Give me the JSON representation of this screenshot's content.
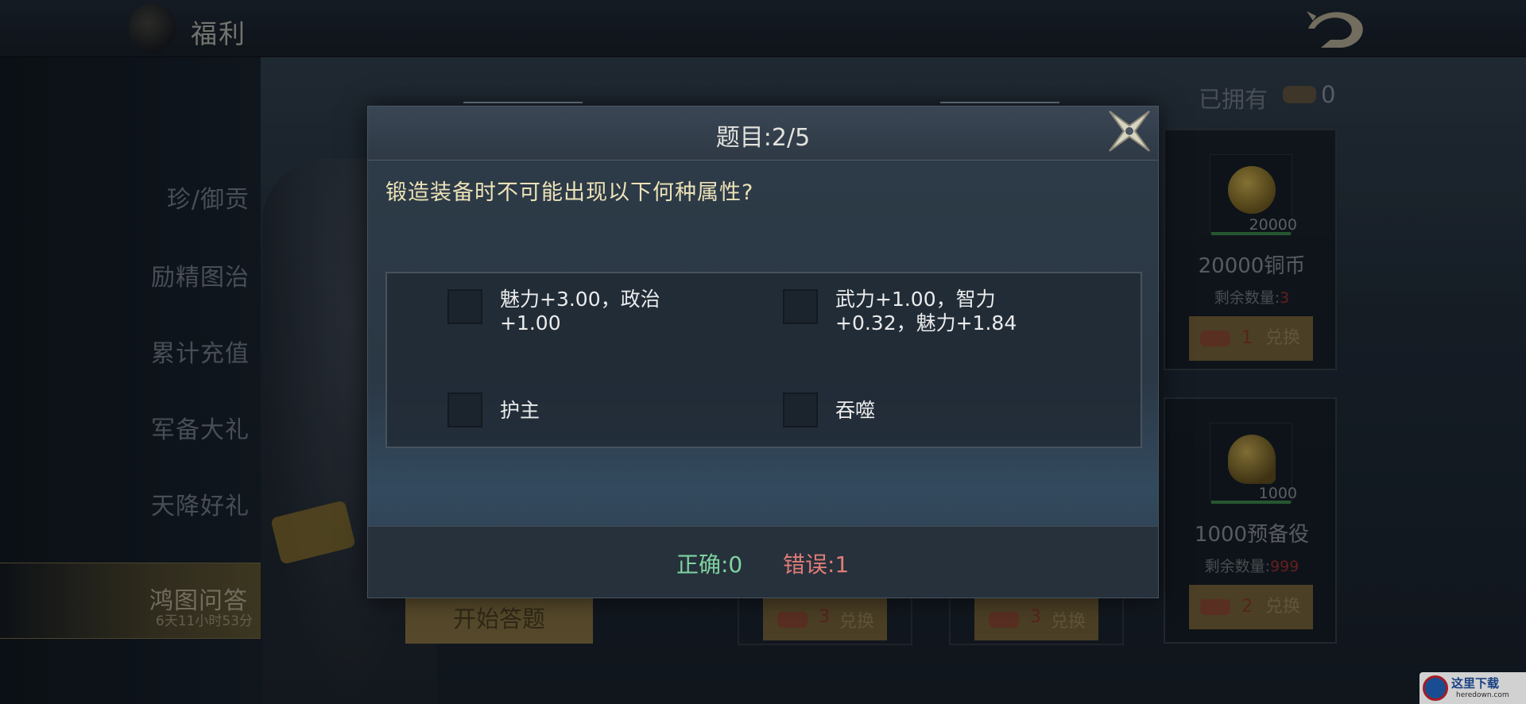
{
  "header": {
    "title": "福利"
  },
  "sidebar": {
    "items": [
      {
        "label": "珍/御贡"
      },
      {
        "label": "励精图治"
      },
      {
        "label": "累计充值"
      },
      {
        "label": "军备大礼"
      },
      {
        "label": "天降好礼"
      },
      {
        "label": "鸿图问答",
        "timer": "6天11小时53分"
      }
    ]
  },
  "owned": {
    "label": "已拥有",
    "count": "0"
  },
  "shop": {
    "cards": [
      {
        "qty": "20000",
        "name": "20000铜币",
        "remain_label": "剩余数量:",
        "remain": "3",
        "cost": "1",
        "button": "兑换"
      },
      {
        "qty": "1000",
        "name": "1000预备役",
        "remain_label": "剩余数量:",
        "remain": "999",
        "cost": "2",
        "button": "兑换"
      }
    ],
    "bottom_buttons": [
      {
        "cost": "3",
        "label": "兑换"
      },
      {
        "cost": "3",
        "label": "兑换"
      }
    ]
  },
  "start_button": "开始答题",
  "quiz": {
    "title": "题目:2/5",
    "question": "锻造装备时不可能出现以下何种属性?",
    "options": [
      {
        "text": "魅力+3.00，政治\n+1.00"
      },
      {
        "text": "武力+1.00，智力\n+0.32，魅力+1.84"
      },
      {
        "text": "护主"
      },
      {
        "text": "吞噬"
      }
    ],
    "correct": "正确:0",
    "wrong": "错误:1"
  },
  "watermark": {
    "text": "这里下载",
    "sub": "heredown.com"
  }
}
